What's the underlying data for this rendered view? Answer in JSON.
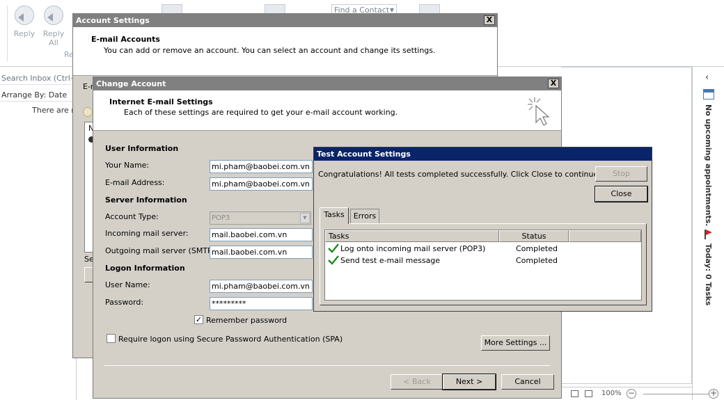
{
  "ribbon": {
    "reply_label": "Reply",
    "reply_all_label": "Reply All",
    "group_label": "Re",
    "find_contact": "Find a Contact"
  },
  "mail": {
    "search_placeholder": "Search Inbox (Ctrl+E)",
    "arrange_by": "Arrange By: Date",
    "empty_text": "There are no items"
  },
  "todo": {
    "appointments": "No upcoming appointments.",
    "tasks": "Today: 0 Tasks"
  },
  "statusbar": {
    "zoom": "100%"
  },
  "account_settings": {
    "title": "Account Settings",
    "close": "X",
    "header_title": "E-mail Accounts",
    "header_desc": "You can add or remove an account. You can select an account and change its settings.",
    "tab_fragment": "E-m",
    "list_col": "N",
    "se_fragment": "Se"
  },
  "change_account": {
    "title": "Change Account",
    "close": "X",
    "header_title": "Internet E-mail Settings",
    "header_desc": "Each of these settings are required to get your e-mail account working.",
    "user_info_section": "User Information",
    "your_name_label": "Your Name:",
    "your_name_value": "mi.pham@baobei.com.vn",
    "email_label": "E-mail Address:",
    "email_value": "mi.pham@baobei.com.vn",
    "server_info_section": "Server Information",
    "account_type_label": "Account Type:",
    "account_type_value": "POP3",
    "incoming_label": "Incoming mail server:",
    "incoming_value": "mail.baobei.com.vn",
    "outgoing_label": "Outgoing mail server (SMTP):",
    "outgoing_value": "mail.baobei.com.vn",
    "logon_section": "Logon Information",
    "username_label": "User Name:",
    "username_value": "mi.pham@baobei.com.vn",
    "password_label": "Password:",
    "password_value": "*********",
    "remember_label": "Remember password",
    "remember_checked": "✓",
    "spa_label": "Require logon using Secure Password Authentication (SPA)",
    "more_settings": "More Settings ...",
    "back": "< Back",
    "next": "Next >",
    "cancel": "Cancel"
  },
  "test_settings": {
    "title": "Test Account Settings",
    "message": "Congratulations! All tests completed successfully. Click Close to continue.",
    "stop": "Stop",
    "close": "Close",
    "tabs": [
      {
        "label": "Tasks"
      },
      {
        "label": "Errors"
      }
    ],
    "columns": {
      "tasks": "Tasks",
      "status": "Status"
    },
    "rows": [
      {
        "task": "Log onto incoming mail server (POP3)",
        "status": "Completed"
      },
      {
        "task": "Send test e-mail message",
        "status": "Completed"
      }
    ]
  }
}
